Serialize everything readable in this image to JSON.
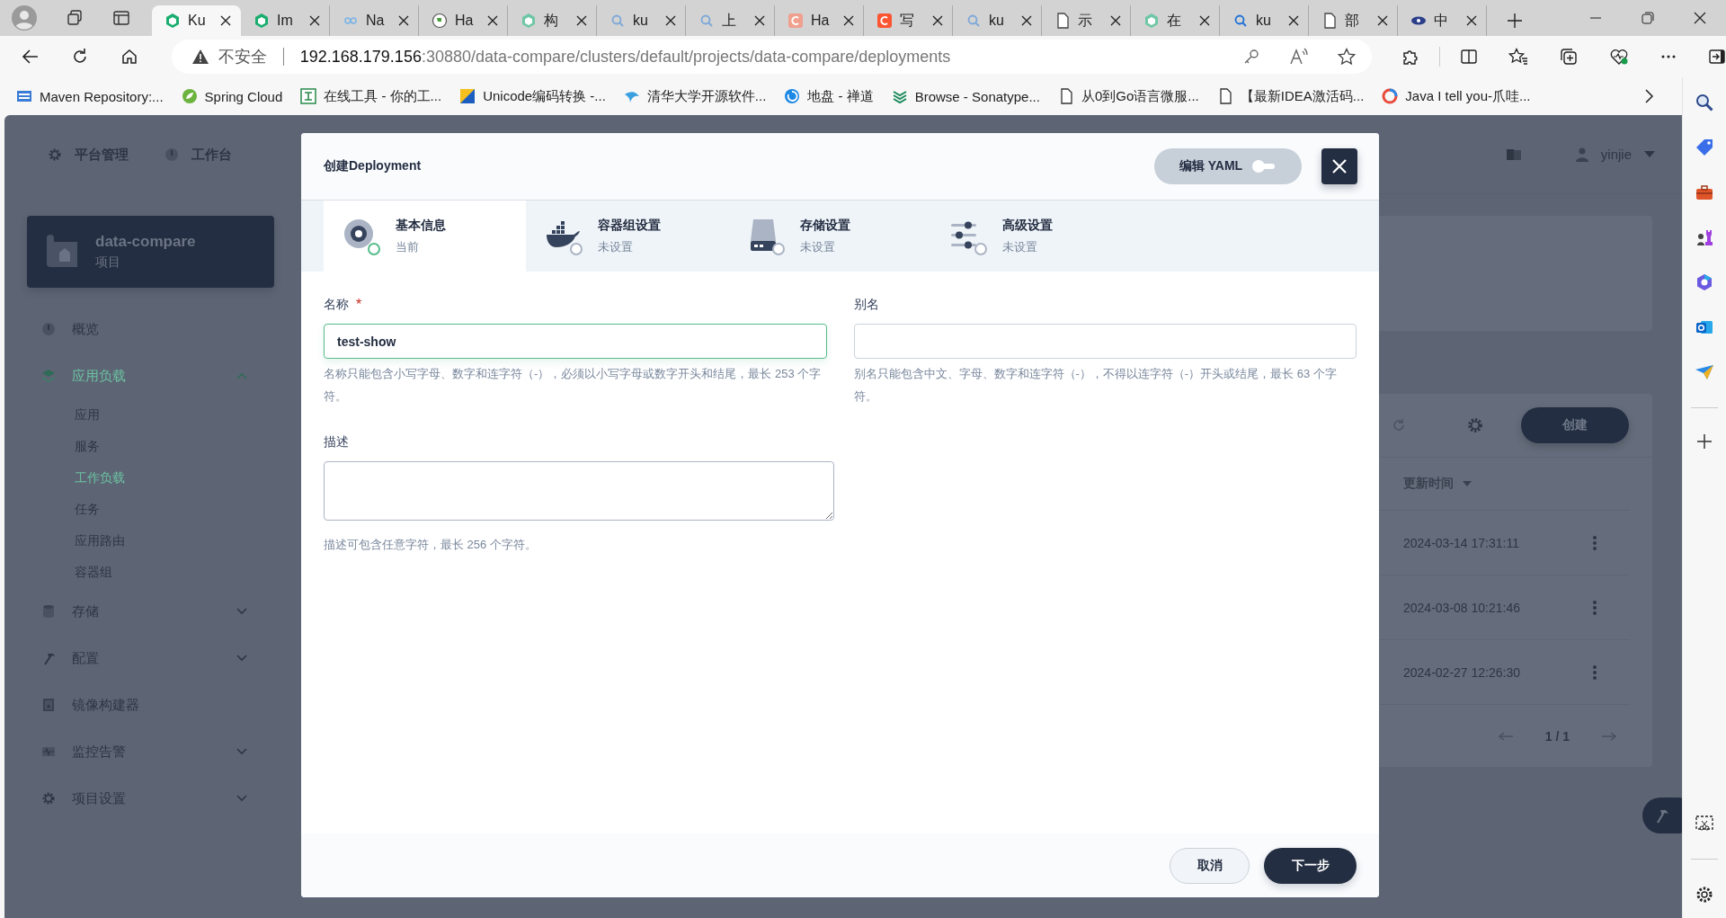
{
  "browser": {
    "tabs": [
      {
        "label": "Ku",
        "selected": true
      },
      {
        "label": "Im",
        "selected": false
      },
      {
        "label": "Na",
        "selected": false
      },
      {
        "label": "Ha",
        "selected": false
      },
      {
        "label": "构",
        "selected": false
      },
      {
        "label": "ku",
        "selected": false
      },
      {
        "label": "上",
        "selected": false
      },
      {
        "label": "Ha",
        "selected": false
      },
      {
        "label": "写",
        "selected": false
      },
      {
        "label": "ku",
        "selected": false
      },
      {
        "label": "示",
        "selected": false
      },
      {
        "label": "在",
        "selected": false
      },
      {
        "label": "ku",
        "selected": false
      },
      {
        "label": "部",
        "selected": false
      },
      {
        "label": "中",
        "selected": false
      }
    ],
    "address": {
      "warning": "不安全",
      "host": "192.168.179.156",
      "path": ":30880/data-compare/clusters/default/projects/data-compare/deployments"
    },
    "bookmarks": [
      "Maven Repository:...",
      "Spring Cloud",
      "在线工具 - 你的工...",
      "Unicode编码转换 -...",
      "清华大学开源软件...",
      "地盘 - 禅道",
      "Browse - Sonatype...",
      "从0到Go语言微服...",
      "【最新IDEA激活码...",
      "Java I tell you-爪哇..."
    ]
  },
  "console": {
    "top_nav": [
      "平台管理",
      "工作台"
    ],
    "user": "yinjie",
    "project": {
      "name": "data-compare",
      "type": "项目"
    },
    "nav": [
      {
        "label": "概览",
        "kind": "link",
        "selected": false
      },
      {
        "label": "应用负载",
        "kind": "group",
        "expanded": true,
        "selected": true,
        "children": [
          {
            "label": "应用",
            "selected": false
          },
          {
            "label": "服务",
            "selected": false
          },
          {
            "label": "工作负载",
            "selected": true
          },
          {
            "label": "任务",
            "selected": false
          },
          {
            "label": "应用路由",
            "selected": false
          },
          {
            "label": "容器组",
            "selected": false
          }
        ]
      },
      {
        "label": "存储",
        "kind": "group",
        "expanded": false,
        "selected": false
      },
      {
        "label": "配置",
        "kind": "group",
        "expanded": false,
        "selected": false
      },
      {
        "label": "镜像构建器",
        "kind": "link",
        "selected": false
      },
      {
        "label": "监控告警",
        "kind": "group",
        "expanded": false,
        "selected": false
      },
      {
        "label": "项目设置",
        "kind": "group",
        "expanded": false,
        "selected": false
      }
    ],
    "create_button": "创建",
    "table": {
      "column": "更新时间",
      "rows": [
        {
          "updated": "2024-03-14 17:31:11"
        },
        {
          "updated": "2024-03-08 10:21:46"
        },
        {
          "updated": "2024-02-27 12:26:30"
        }
      ]
    },
    "pagination": "1 / 1"
  },
  "modal": {
    "title": "创建Deployment",
    "yaml_toggle": {
      "label": "编辑 YAML",
      "on": false
    },
    "steps": [
      {
        "title": "基本信息",
        "status": "当前",
        "selected": true
      },
      {
        "title": "容器组设置",
        "status": "未设置",
        "selected": false
      },
      {
        "title": "存储设置",
        "status": "未设置",
        "selected": false
      },
      {
        "title": "高级设置",
        "status": "未设置",
        "selected": false
      }
    ],
    "fields": [
      {
        "kind": "input",
        "label": "名称",
        "required_mark": "*",
        "value": "test-show",
        "focused": true,
        "hint": "名称只能包含小写字母、数字和连字符（-），必须以小写字母或数字开头和结尾，最长 253 个字符。"
      },
      {
        "kind": "input",
        "label": "别名",
        "focused": false,
        "hint": "别名只能包含中文、字母、数字和连字符（-），不得以连字符（-）开头或结尾，最长 63 个字符。"
      },
      {
        "kind": "textarea",
        "label": "描述",
        "focused": false,
        "hint": "描述可包含任意字符，最长 256 个字符。"
      }
    ],
    "buttons": {
      "cancel": "取消",
      "next": "下一步"
    }
  }
}
